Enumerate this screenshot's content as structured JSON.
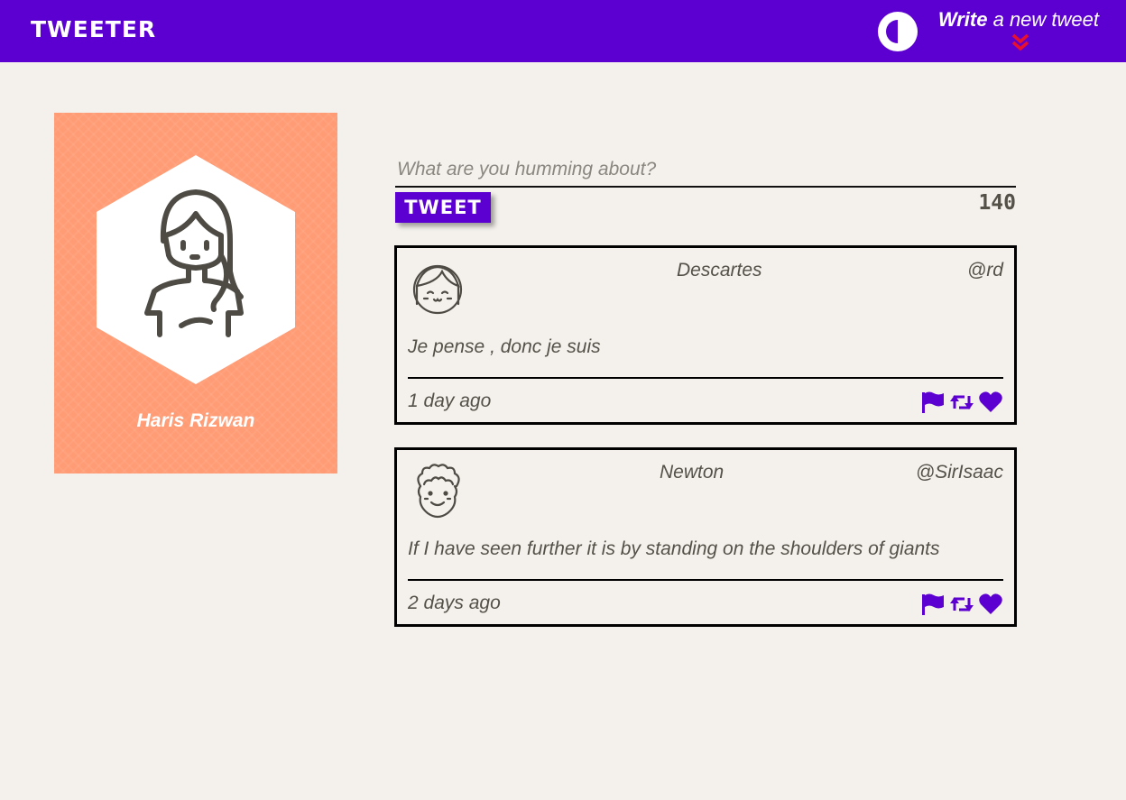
{
  "navbar": {
    "brand": "TWEETER",
    "theme_toggle_icon": "half-moon-contrast-icon",
    "write_prefix": "Write",
    "write_suffix": " a new tweet",
    "write_icon": "double-chevron-down-icon"
  },
  "colors": {
    "brand": "#5c00d2",
    "background": "#f4f1ec",
    "profile_card": "#ff9c75",
    "text": "#545149",
    "chevron": "#e8102d"
  },
  "profile": {
    "name": "Haris Rizwan",
    "avatar_icon": "woman-avatar-icon"
  },
  "composer": {
    "placeholder": "What are you humming about?",
    "button_label": "TWEET",
    "char_count": "140"
  },
  "tweets": [
    {
      "author": "Descartes",
      "handle": "@rd",
      "body": "Je pense , donc je suis",
      "time": "1 day ago",
      "avatar_icon": "girl-face-icon"
    },
    {
      "author": "Newton",
      "handle": "@SirIsaac",
      "body": "If I have seen further it is by standing on the shoulders of giants",
      "time": "2 days ago",
      "avatar_icon": "curly-hair-face-icon"
    }
  ],
  "tweet_actions": {
    "flag_icon": "flag-icon",
    "retweet_icon": "retweet-icon",
    "like_icon": "heart-icon"
  }
}
